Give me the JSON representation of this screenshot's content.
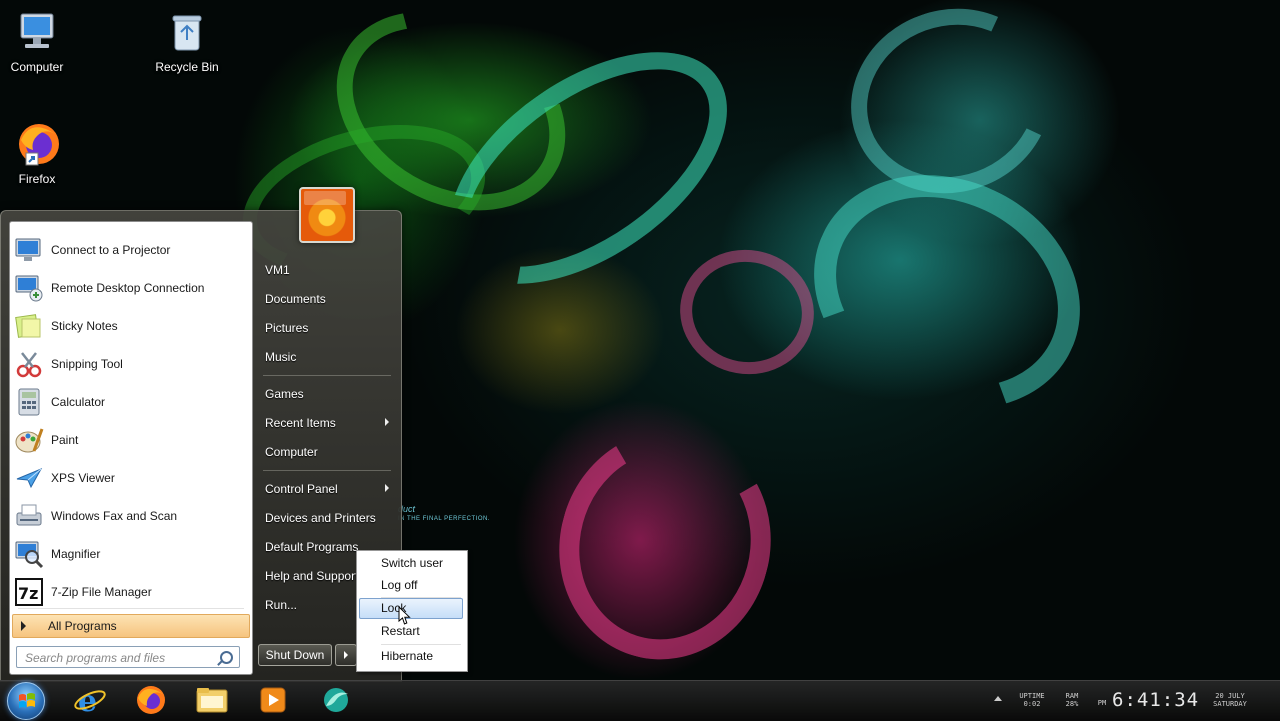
{
  "desktop": {
    "icons": [
      {
        "label": "Computer",
        "icon": "computer-icon"
      },
      {
        "label": "Recycle Bin",
        "icon": "recycle-bin-icon"
      },
      {
        "label": "Firefox",
        "icon": "firefox-icon"
      }
    ],
    "wallpaper_text": [
      "duct",
      "IN THE FINAL PERFECTION."
    ]
  },
  "start_menu": {
    "pinned_programs": [
      {
        "label": "Connect to a Projector",
        "icon": "projector-icon"
      },
      {
        "label": "Remote Desktop Connection",
        "icon": "remote-desktop-icon"
      },
      {
        "label": "Sticky Notes",
        "icon": "sticky-notes-icon"
      },
      {
        "label": "Snipping Tool",
        "icon": "snipping-tool-icon"
      },
      {
        "label": "Calculator",
        "icon": "calculator-icon"
      },
      {
        "label": "Paint",
        "icon": "paint-icon"
      },
      {
        "label": "XPS Viewer",
        "icon": "xps-viewer-icon"
      },
      {
        "label": "Windows Fax and Scan",
        "icon": "fax-scan-icon"
      },
      {
        "label": "Magnifier",
        "icon": "magnifier-icon"
      },
      {
        "label": "7-Zip File Manager",
        "icon": "7zip-icon"
      }
    ],
    "all_programs_label": "All Programs",
    "search_placeholder": "Search programs and files",
    "right_pane": {
      "user": "VM1",
      "items": [
        {
          "label": "Documents"
        },
        {
          "label": "Pictures"
        },
        {
          "label": "Music"
        },
        {
          "label": "Games"
        },
        {
          "label": "Recent Items",
          "has_submenu": true
        },
        {
          "label": "Computer"
        },
        {
          "label": "Control Panel",
          "has_submenu": true
        },
        {
          "label": "Devices and Printers"
        },
        {
          "label": "Default Programs"
        },
        {
          "label": "Help and Support"
        },
        {
          "label": "Run..."
        }
      ]
    },
    "shutdown_label": "Shut Down",
    "shutdown_options": [
      "Switch user",
      "Log off",
      "Lock",
      "Restart",
      "Hibernate"
    ],
    "highlighted_option": "Lock"
  },
  "taskbar": {
    "pinned": [
      "internet-explorer-icon",
      "firefox-icon",
      "file-explorer-icon",
      "media-player-icon",
      "app-icon"
    ],
    "tray": {
      "uptime_label": "UPTIME",
      "uptime_value": "0:02",
      "ram_label": "RAM",
      "ram_value": "28%",
      "ampm": "PM",
      "time": "6:41:34",
      "date": "20 JULY",
      "day": "SATURDAY"
    }
  },
  "colors": {
    "all_programs_bg": "#f6c47f",
    "highlight": "#c6def8",
    "start_orb": "#2a6fb8"
  }
}
